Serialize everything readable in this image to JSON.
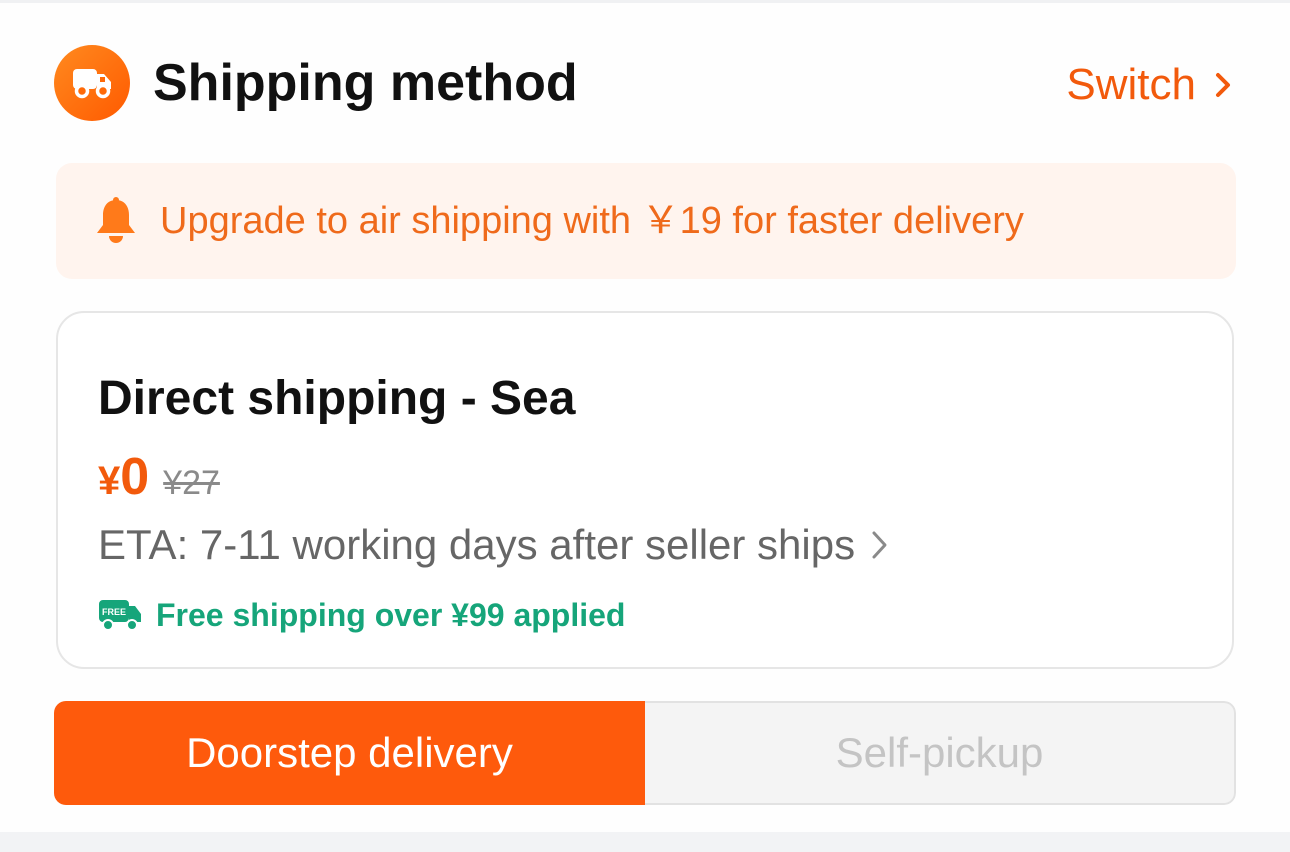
{
  "header": {
    "icon": "truck-icon",
    "title": "Shipping method",
    "switch_label": "Switch",
    "switch_icon": "chevron-right-icon"
  },
  "banner": {
    "icon": "bell-icon",
    "text": "Upgrade to air shipping with ￥19 for faster delivery"
  },
  "option": {
    "title": "Direct shipping - Sea",
    "price_currency": "¥",
    "price_now": "0",
    "price_original": "¥27",
    "eta": "ETA: 7-11 working days after seller ships",
    "eta_icon": "chevron-right-icon",
    "free_icon": "free-shipping-truck-icon",
    "free_badge": "FREE",
    "free_text": "Free shipping over ¥99 applied"
  },
  "delivery_toggle": {
    "options": [
      {
        "label": "Doorstep delivery",
        "selected": true
      },
      {
        "label": "Self-pickup",
        "selected": false
      }
    ]
  },
  "colors": {
    "accent": "#fe5a0c",
    "accent_text": "#f25a0c",
    "banner_bg": "#fff4ee",
    "free_green": "#16a57a"
  }
}
